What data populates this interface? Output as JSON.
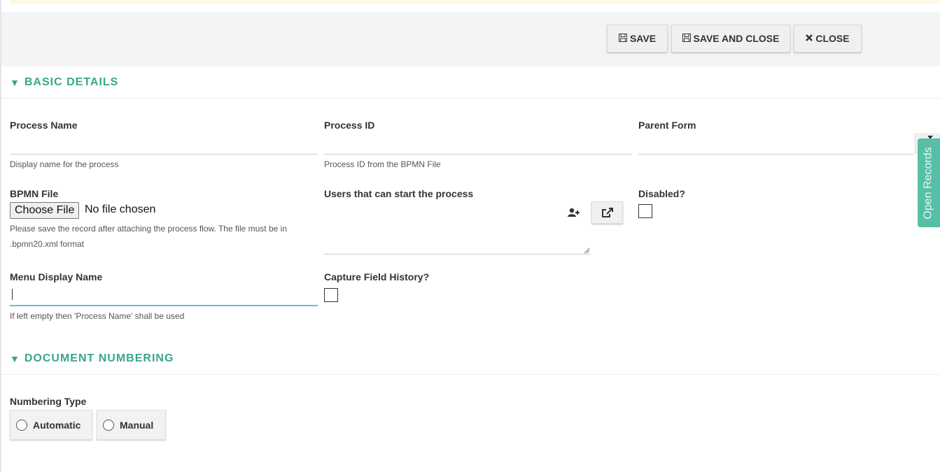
{
  "toolbar": {
    "save_label": "SAVE",
    "save_close_label": "SAVE AND CLOSE",
    "close_label": "CLOSE"
  },
  "sections": {
    "basic_details": "BASIC DETAILS",
    "document_numbering": "DOCUMENT NUMBERING"
  },
  "fields": {
    "process_name": {
      "label": "Process Name",
      "help": "Display name for the process",
      "value": ""
    },
    "process_id": {
      "label": "Process ID",
      "help": "Process ID from the BPMN File",
      "value": ""
    },
    "parent_form": {
      "label": "Parent Form",
      "value": ""
    },
    "bpmn_file": {
      "label": "BPMN File",
      "button": "Choose File",
      "status": "No file chosen",
      "help_line1": "Please save the record after attaching the process flow. The file must be in",
      "help_line2": ".bpmn20.xml format"
    },
    "users": {
      "label": "Users that can start the process"
    },
    "disabled": {
      "label": "Disabled?",
      "checked": false
    },
    "menu_display_name": {
      "label": "Menu Display Name",
      "help": "If left empty then 'Process Name' shall be used",
      "value": ""
    },
    "capture_history": {
      "label": "Capture Field History?",
      "checked": false
    },
    "numbering_type": {
      "label": "Numbering Type",
      "options": [
        "Automatic",
        "Manual"
      ]
    }
  },
  "side_tab": {
    "label": "Open Records"
  },
  "icons": {
    "save": "floppy-icon",
    "close": "x-icon",
    "section": "triangle-down-icon",
    "user_add": "user-plus-icon",
    "external": "external-link-icon"
  },
  "colors": {
    "accent": "#3aa58e",
    "side_tab": "#57bfa5",
    "focus": "#5bc0de",
    "notice": "#fcf8e3"
  }
}
